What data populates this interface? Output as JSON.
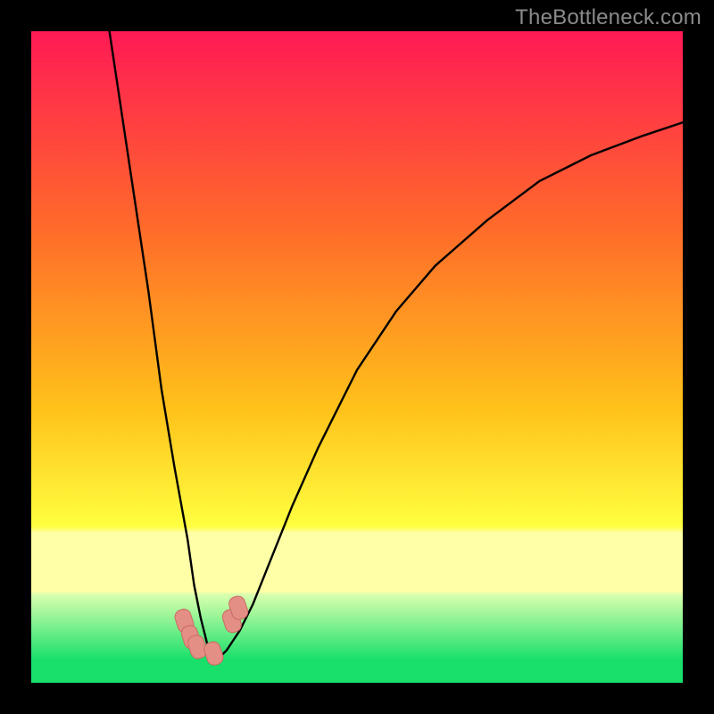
{
  "watermark": "TheBottleneck.com",
  "colors": {
    "top": "#ff1a55",
    "mid1": "#ff6a2a",
    "mid2": "#ffc21a",
    "mid3": "#ffff40",
    "pale": "#ffffa8",
    "green": "#18e06a",
    "curve": "#000000",
    "marker_fill": "#e48f86",
    "marker_stroke": "#c96b61"
  },
  "chart_data": {
    "type": "line",
    "title": "",
    "xlabel": "",
    "ylabel": "",
    "xlim": [
      0,
      100
    ],
    "ylim": [
      0,
      100
    ],
    "series": [
      {
        "name": "bottleneck-curve",
        "x": [
          12,
          15,
          18,
          20,
          22,
          24,
          25,
          26,
          27,
          28,
          29,
          30,
          32,
          34,
          36,
          40,
          44,
          50,
          56,
          62,
          70,
          78,
          86,
          94,
          100
        ],
        "values": [
          100,
          80,
          60,
          45,
          33,
          22,
          15,
          10,
          6,
          4,
          4,
          5,
          8,
          12,
          17,
          27,
          36,
          48,
          57,
          64,
          71,
          77,
          81,
          84,
          86
        ]
      }
    ],
    "markers": [
      {
        "x": 23.5,
        "y": 9.5
      },
      {
        "x": 24.5,
        "y": 7.0
      },
      {
        "x": 25.5,
        "y": 5.5
      },
      {
        "x": 28.0,
        "y": 4.5
      },
      {
        "x": 30.8,
        "y": 9.5
      },
      {
        "x": 31.8,
        "y": 11.5
      }
    ]
  }
}
